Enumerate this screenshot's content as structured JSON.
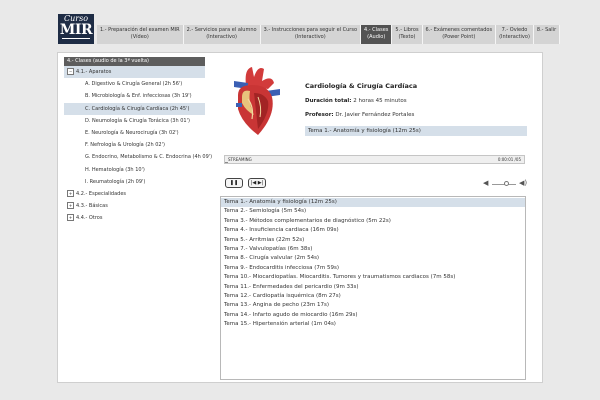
{
  "logo": {
    "line1": "Curso",
    "line2": "MIR"
  },
  "nav": [
    {
      "line1": "1.- Preparación del examen MIR",
      "line2": "(Vídeo)"
    },
    {
      "line1": "2.- Servicios para el alumno",
      "line2": "(Interactivo)"
    },
    {
      "line1": "3.- Instrucciones para seguir el Curso",
      "line2": "(Interactivo)"
    },
    {
      "line1": "4.- Clases",
      "line2": "(Audio)"
    },
    {
      "line1": "5.- Libros",
      "line2": "(Texto)"
    },
    {
      "line1": "6.- Exámenes comentados",
      "line2": "(Power Point)"
    },
    {
      "line1": "7.- Oviedo",
      "line2": "(Interactivo)"
    },
    {
      "line1": "8.- Salir",
      "line2": ""
    }
  ],
  "sidebar": {
    "header": "4.- Clases (audio de la 3ª vuelta)",
    "group1": {
      "toggle": "−",
      "label": "4.1.- Aparatos"
    },
    "subitems": [
      "A. Digestivo & Cirugía General (2h 56')",
      "B. Microbiología & Enf. infecciosas (3h 19')",
      "C. Cardiología & Cirugía Cardíaca (2h 45')",
      "D. Neumología & Cirugía Torácica (3h 01')",
      "E. Neurología & Neurocirugía (3h 02')",
      "F. Nefrología & Urología (2h 02')",
      "G. Endocrino, Metabolismo & C. Endocrina (4h 09')",
      "H. Hematología (3h 10')",
      "I. Reumatología (2h 09')"
    ],
    "groups": [
      {
        "toggle": "+",
        "label": "4.2.- Especialidades"
      },
      {
        "toggle": "+",
        "label": "4.3.- Básicas"
      },
      {
        "toggle": "+",
        "label": "4.4.- Otros"
      }
    ]
  },
  "course": {
    "title": "Cardiología & Cirugía Cardíaca",
    "duration_label": "Duración total:",
    "duration_value": "2 horas 45 minutos",
    "professor_label": "Profesor:",
    "professor_value": "Dr. Javier Fernández Portales",
    "current_topic": "Tema 1.- Anatomía y fisiología (12m 25s)"
  },
  "player": {
    "status": "STREAMING",
    "time": "0:00:01 /05",
    "progress": 0.01,
    "play_icon": "pause-icon",
    "play_label": "❚❚",
    "skip_label": "|◀ ▶|",
    "volume_level": 0.6
  },
  "topics": [
    "Tema 1.- Anatomía y fisiología (12m 25s)",
    "Tema 2.- Semiología (5m 54s)",
    "Tema 3.- Métodos complementarios de diagnóstico (5m 22s)",
    "Tema 4.- Insuficiencia cardiaca (16m 09s)",
    "Tema 5.- Arritmias (22m 52s)",
    "Tema 7.- Valvulopatías (6m 38s)",
    "Tema 8.- Cirugía valvular (2m 54s)",
    "Tema 9.- Endocarditis infecciosa (7m 59s)",
    "Tema 10.- Miocardiopatías. Miocarditis. Tumores y traumatismos cardiacos (7m 58s)",
    "Tema 11.- Enfermedades del pericardio (9m 33s)",
    "Tema 12.- Cardiopatía isquémica (8m 27s)",
    "Tema 13.- Angina de pecho (23m 17s)",
    "Tema 14.- Infarto agudo de miocardio (16m 29s)",
    "Tema 15.- Hipertensión arterial (1m 04s)"
  ],
  "colors": {
    "active_tab": "#535353",
    "selection": "#d5dfe9",
    "logo_bg": "#1e2c45"
  }
}
